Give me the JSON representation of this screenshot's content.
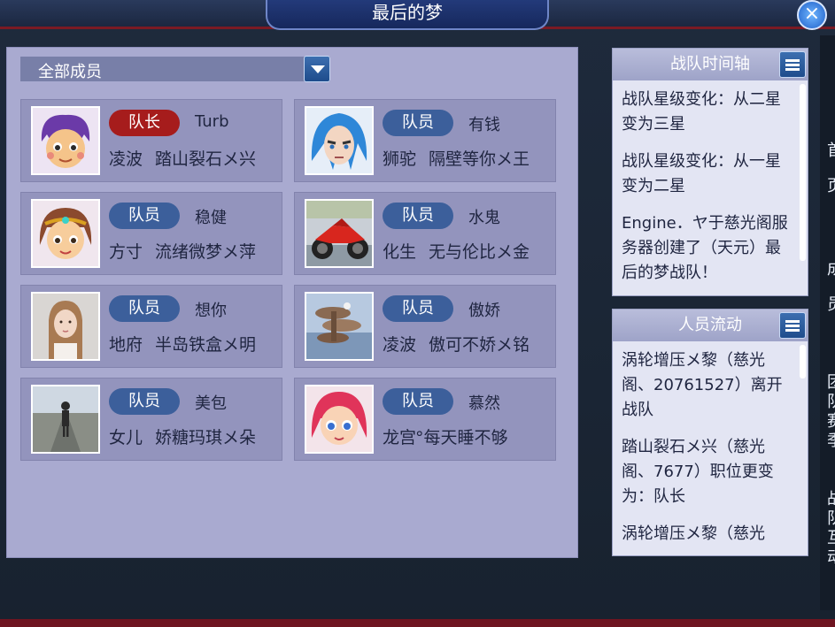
{
  "window": {
    "title": "最后的梦",
    "close_icon": "×"
  },
  "filter": {
    "selected": "全部成员"
  },
  "members": [
    {
      "role": "队长",
      "nickname": "Turb",
      "sect": "凌波",
      "name": "踏山裂石メ兴",
      "avatar": "purple-hair-boy"
    },
    {
      "role": "队员",
      "nickname": "有钱",
      "sect": "狮驼",
      "name": "隔壁等你メ王",
      "avatar": "blue-hair-warrior"
    },
    {
      "role": "队员",
      "nickname": "稳健",
      "sect": "方寸",
      "name": "流绪微梦メ萍",
      "avatar": "girl-with-circlet"
    },
    {
      "role": "队员",
      "nickname": "水鬼",
      "sect": "化生",
      "name": "无与伦比メ金",
      "avatar": "red-motorcycle-photo"
    },
    {
      "role": "队员",
      "nickname": "想你",
      "sect": "地府",
      "name": "半岛铁盒メ明",
      "avatar": "girl-photo"
    },
    {
      "role": "队员",
      "nickname": "傲娇",
      "sect": "凌波",
      "name": "傲可不娇メ铭",
      "avatar": "rock-scenery-photo"
    },
    {
      "role": "队员",
      "nickname": "美包",
      "sect": "女儿",
      "name": "娇糖玛琪メ朵",
      "avatar": "road-walker-photo"
    },
    {
      "role": "队员",
      "nickname": "慕然",
      "sect": "龙宫",
      "name": "°每天睡不够",
      "avatar": "pink-hair-girl"
    }
  ],
  "timeline": {
    "title": "战队时间轴",
    "entries": [
      "战队星级变化：从二星变为三星",
      "战队星级变化：从一星变为二星",
      "Engine．ヤ于慈光阁服务器创建了（天元）最后的梦战队！"
    ]
  },
  "flow": {
    "title": "人员流动",
    "entries": [
      "涡轮增压メ黎（慈光阁、20761527）离开战队",
      "踏山裂石メ兴（慈光阁、7677）职位更变为：队长",
      "涡轮增压メ黎（慈光"
    ]
  },
  "right_edge": [
    "首",
    "页",
    "成",
    "员",
    "团",
    "队",
    "赛",
    "季",
    "战",
    "队",
    "互",
    "动"
  ],
  "colors": {
    "leader": "#a61c1c",
    "member": "#3c5f9b",
    "panel": "#a9aad0"
  }
}
